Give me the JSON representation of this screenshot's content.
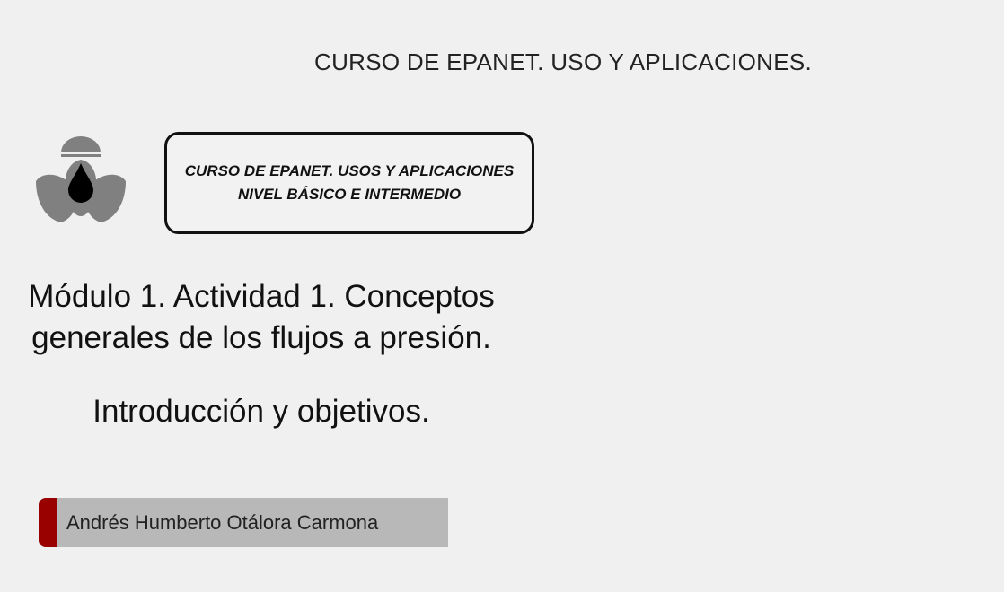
{
  "header": {
    "title": "CURSO DE EPANET. USO Y APLICACIONES."
  },
  "logo": {
    "icon": "water-drop-leaves-logo",
    "color": "#808080"
  },
  "course_box": {
    "line1": "CURSO DE EPANET. USOS Y APLICACIONES",
    "line2": "NIVEL BÁSICO E INTERMEDIO"
  },
  "module": {
    "line1": "Módulo 1. Actividad 1. Conceptos",
    "line2": "generales de los flujos a presión."
  },
  "subtitle": "Introducción y objetivos.",
  "author": {
    "name": "Andrés Humberto Otálora Carmona",
    "accent_color": "#990000",
    "bar_color": "#b8b8b8"
  }
}
